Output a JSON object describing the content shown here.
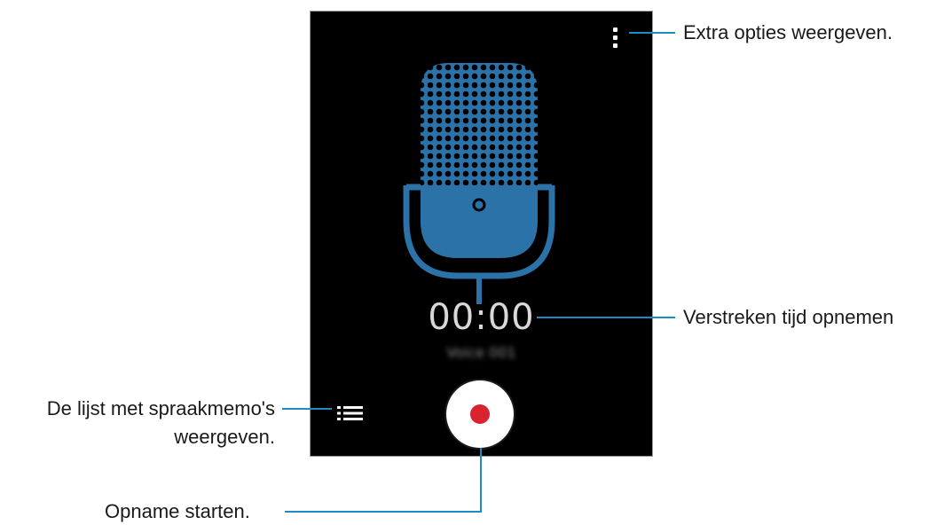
{
  "screen": {
    "timer": "00:00",
    "filename": "Voice 001",
    "buttons": {
      "more_options": "more-options-icon",
      "list": "list-icon",
      "record": "record-icon"
    }
  },
  "callouts": {
    "more_options": "Extra opties weergeven.",
    "elapsed": "Verstreken tijd opnemen",
    "list_line1": "De lijst met spraakmemo's",
    "list_line2": "weergeven.",
    "record": "Opname starten."
  },
  "colors": {
    "accent": "#1e8bc3",
    "mic_blue": "#2a72a8",
    "record": "#d9232e",
    "background": "#000000"
  }
}
